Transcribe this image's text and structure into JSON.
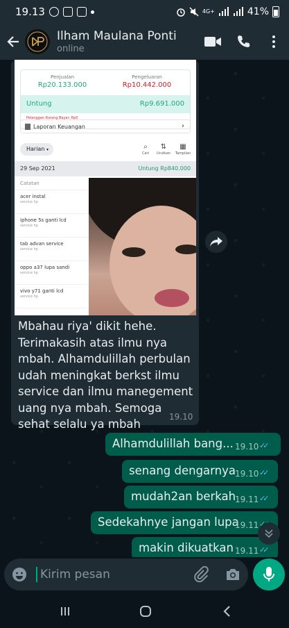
{
  "status_bar": {
    "time": "19.13",
    "network": "4G+",
    "battery": "41%"
  },
  "header": {
    "contact_name": "Ilham Maulana Ponti",
    "contact_status": "online"
  },
  "shared_screenshot": {
    "sales_label": "Penjualan",
    "sales_value": "Rp20.133.000",
    "expense_label": "Pengeluaran",
    "expense_value": "Rp10.442.000",
    "profit_label": "Untung",
    "profit_value": "Rp9.691.000",
    "debt_note": "Pelanggan Kurang Bayar: Rp0",
    "report_label": "Laporan Keuangan",
    "period_filter": "Harian",
    "tool_search": "Cari",
    "tool_sort": "Urutkan",
    "tool_view": "Tampilan",
    "date": "29 Sep 2021",
    "day_profit": "Untung Rp840.000",
    "list_header": "Catatan",
    "items": [
      {
        "title": "acer instal",
        "sub": "service hp"
      },
      {
        "title": "iphone 5s ganti lcd",
        "sub": "service hp"
      },
      {
        "title": "tab advan service",
        "sub": "service hp"
      },
      {
        "title": "oppo a37 lupa sandi",
        "sub": "service hp"
      },
      {
        "title": "vivo y71 ganti lcd",
        "sub": "service hp"
      }
    ]
  },
  "incoming_message": {
    "text": "Mbahau riya' dikit hehe. Terimakasih atas ilmu nya mbah. Alhamdulillah perbulan udah meningkat berkst ilmu service dan ilmu manegement uang nya mbah. Semoga sehat selalu ya mbah",
    "time": "19.10"
  },
  "outgoing_messages": [
    {
      "text": "Alhamdulillah bang...",
      "time": "19.10"
    },
    {
      "text": "senang dengarnya",
      "time": "19.10"
    },
    {
      "text": "mudah2an berkah",
      "time": "19.11"
    },
    {
      "text": "Sedekahnye jangan lupa",
      "time": "19.11"
    },
    {
      "text": "makin dikuatkan",
      "time": "19.11"
    }
  ],
  "composer": {
    "placeholder": "Kirim pesan"
  },
  "colors": {
    "header_bg": "#1f2c34",
    "chat_bg": "#0b141a",
    "incoming_bubble": "#1f2c34",
    "outgoing_bubble": "#005c4b",
    "accent": "#00a884",
    "read_ticks": "#53bdeb"
  }
}
